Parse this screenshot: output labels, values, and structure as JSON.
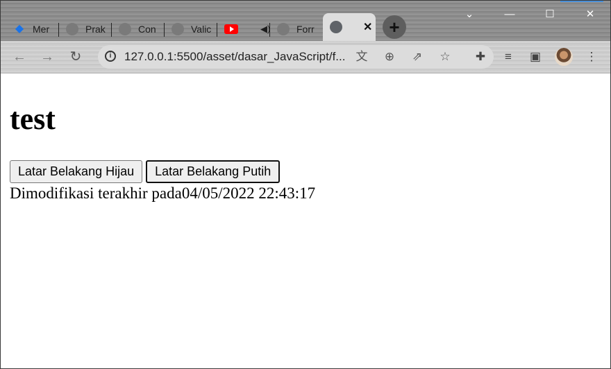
{
  "browser": {
    "tabs": [
      {
        "label": "Mer",
        "icon": "blue-diamond-icon"
      },
      {
        "label": "Prak",
        "icon": "globe-icon"
      },
      {
        "label": "Con",
        "icon": "globe-icon"
      },
      {
        "label": "Valic",
        "icon": "globe-icon"
      },
      {
        "label": "",
        "icon": "youtube-icon"
      },
      {
        "label": "Forr",
        "icon": "globe-icon"
      }
    ],
    "active_tab": {
      "label": "",
      "icon": "globe-icon"
    },
    "url": "127.0.0.1:5500/asset/dasar_JavaScript/f..."
  },
  "page": {
    "heading": "test",
    "buttons": {
      "green": "Latar Belakang Hijau",
      "white": "Latar Belakang Putih"
    },
    "modified_label": "Dimodifikasi terakhir pada",
    "modified_value": "04/05/2022 22:43:17"
  },
  "colors": {
    "accent": "#4a8fd8",
    "youtube": "#ff0000"
  }
}
